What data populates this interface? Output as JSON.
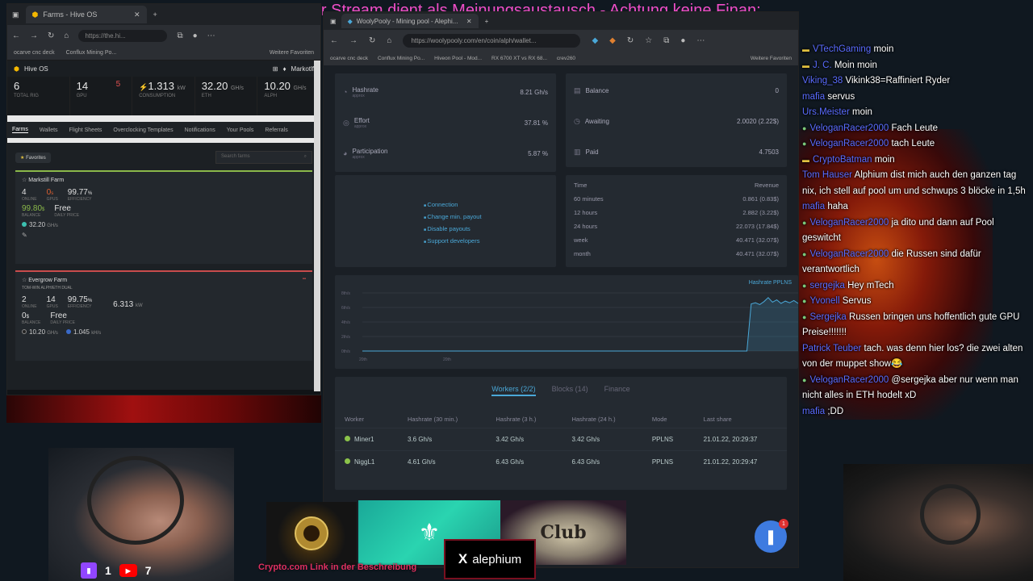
{
  "ticker": "zberatung, dieser Stream dient als Meinungsaustausch - Achtung keine Finan:",
  "left_browser": {
    "tab_title": "Farms - Hive OS",
    "url": "https://the.hi...",
    "bookmarks": [
      "ocarve cnc deck",
      "Conflux Mining Po...",
      "Weitere Favoriten"
    ],
    "app_name": "Hive OS",
    "menu_right": "Markotlf",
    "stats": [
      {
        "value": "6",
        "unit": "",
        "label": "TOTAL RIG"
      },
      {
        "value": "14",
        "unit": "",
        "extra": "5",
        "label": "GPU"
      },
      {
        "value": "1.313",
        "unit": "kW",
        "label": "CONSUMPTION"
      },
      {
        "value": "32.20",
        "unit": "GH/s",
        "label": "ETH"
      },
      {
        "value": "10.20",
        "unit": "GH/s",
        "label": "ALPH"
      }
    ],
    "tabs": [
      "Farms",
      "Wallets",
      "Flight Sheets",
      "Overclocking Templates",
      "Notifications",
      "Your Pools",
      "Referrals"
    ],
    "favorites_label": "Favorites",
    "search_placeholder": "Search farms",
    "farms": [
      {
        "name": "Markstill Farm",
        "online": "4",
        "online_label": "ONLINE",
        "gpus": "0",
        "gpus_unit": "s",
        "gpus_label": "GPUS",
        "efficiency": "99.77",
        "efficiency_unit": "%",
        "efficiency_label": "EFFICIENCY",
        "balance": "99.80",
        "balance_unit": "$",
        "balance_label": "BALANCE",
        "daily": "Free",
        "daily_label": "DAILY PRICE",
        "hashrate": "32.20",
        "hashrate_unit": "GH/s"
      },
      {
        "name": "Evergrow Farm",
        "sub": "TOM-WIN  ALPH/ETH DUAL",
        "online": "2",
        "online_label": "ONLINE",
        "gpus": "14",
        "gpus_label": "GPUS",
        "efficiency": "99.75",
        "efficiency_unit": "%",
        "efficiency_label": "EFFICIENCY",
        "power": "6.313",
        "power_unit": "kW",
        "balance": "0",
        "balance_unit": "$",
        "balance_label": "BALANCE",
        "daily": "Free",
        "daily_label": "DAILY PRICE",
        "hash1": "10.20",
        "hash1_unit": "GH/s",
        "hash2": "1.045",
        "hash2_unit": "kH/s"
      }
    ]
  },
  "center_browser": {
    "tab_title": "WoolyPooly - Mining pool - Alephi...",
    "url": "https://woolypooly.com/en/coin/alph/wallet...",
    "bookmarks": [
      "ocarve cnc deck",
      "Conflux Mining Po...",
      "Hiveon Pool - Mod...",
      "RX 6700 XT vs RX 68...",
      "crev260",
      "Weitere Favoriten"
    ],
    "stats_left": [
      {
        "label": "Hashrate",
        "sub": "approx",
        "value": "8.21 Gh/s",
        "icon": "gauge-icon"
      },
      {
        "label": "Effort",
        "sub": "approx",
        "value": "37.81 %",
        "icon": "target-icon"
      },
      {
        "label": "Participation",
        "sub": "approx",
        "value": "5.87 %",
        "icon": "pie-icon"
      }
    ],
    "stats_right": [
      {
        "label": "Balance",
        "value": "0",
        "icon": "wallet-icon"
      },
      {
        "label": "Awaiting",
        "value": "2.0020 (2.22$)",
        "icon": "clock-icon"
      },
      {
        "label": "Paid",
        "value": "4.7503",
        "icon": "coins-icon"
      }
    ],
    "links": [
      "Connection",
      "Change min. payout",
      "Disable payouts",
      "Support developers"
    ],
    "revenue": {
      "headers": [
        "Time",
        "Revenue"
      ],
      "rows": [
        [
          "60 minutes",
          "0.861 (0.83$)"
        ],
        [
          "12 hours",
          "2.882 (3.22$)"
        ],
        [
          "24 hours",
          "22.073 (17.84$)"
        ],
        [
          "week",
          "40.471 (32.07$)"
        ],
        [
          "month",
          "40.471 (32.07$)"
        ]
      ]
    },
    "chart_legend": "Hashrate PPLNS",
    "chart_data": {
      "type": "line",
      "title": "",
      "xlabel": "",
      "ylabel": "",
      "y_ticks": [
        "8th/s",
        "6th/s",
        "4th/s",
        "2th/s",
        "0th/s"
      ],
      "x_ticks": [
        "20th",
        "20th"
      ],
      "ylim": [
        0,
        10
      ],
      "series": [
        {
          "name": "Hashrate PPLNS",
          "values": [
            0,
            0,
            0,
            0,
            0,
            0,
            0,
            0,
            0,
            0,
            0,
            0,
            0,
            0,
            0,
            0,
            0,
            0,
            0,
            0,
            0,
            0,
            0,
            0,
            0,
            0,
            0,
            0,
            0,
            0,
            0,
            0,
            0,
            0,
            0,
            0,
            0,
            0,
            0,
            0,
            0,
            0,
            0,
            0,
            0,
            0,
            0,
            0,
            0,
            0,
            0,
            0,
            0,
            0,
            0,
            0,
            0,
            0,
            0,
            0,
            0,
            0,
            0,
            0,
            0,
            0,
            0,
            0,
            0,
            0,
            0,
            0,
            0,
            0,
            0,
            0,
            0,
            0,
            0,
            0,
            0,
            0,
            0,
            0,
            0,
            0,
            0,
            0,
            0,
            0,
            0,
            8.1,
            8.3,
            8.0,
            8.5,
            9.2,
            8.4,
            8.8,
            8.2,
            8.6,
            8.3,
            8.7,
            8.2
          ]
        }
      ]
    },
    "worker_tabs": [
      "Workers  (2/2)",
      "Blocks  (14)",
      "Finance"
    ],
    "worker_headers": [
      "Worker",
      "Hashrate (30 min.)",
      "Hashrate (3 h.)",
      "Hashrate (24 h.)",
      "Mode",
      "Last share"
    ],
    "workers": [
      [
        "Miner1",
        "3.6 Gh/s",
        "3.42 Gh/s",
        "3.42 Gh/s",
        "PPLNS",
        "21.01.22, 20:29:37"
      ],
      [
        "NiggL1",
        "4.61 Gh/s",
        "6.43 Gh/s",
        "6.43 Gh/s",
        "PPLNS",
        "21.01.22, 20:29:47"
      ]
    ],
    "chat_badge": "1"
  },
  "chat": [
    {
      "user": "VTechGaming",
      "text": "moin",
      "icon": "star"
    },
    {
      "user": "J. C.",
      "text": "Moin moin",
      "icon": "star"
    },
    {
      "user": "Viking_38",
      "text": "Vikink38=Raffiniert Ryder",
      "icon": ""
    },
    {
      "user": "mafia",
      "text": "servus",
      "icon": ""
    },
    {
      "user": "Urs.Meister",
      "text": "moin",
      "icon": ""
    },
    {
      "user": "VeloganRacer2000",
      "text": "Fach Leute",
      "icon": "heart"
    },
    {
      "user": "VeloganRacer2000",
      "text": "tach Leute",
      "icon": "heart"
    },
    {
      "user": "CryptoBatman",
      "text": "moin",
      "icon": "star"
    },
    {
      "user": "Tom Hauser",
      "text": "Alphium dist mich auch den ganzen tag nix, ich stell auf pool um und schwups 3 blöcke in 1,5h",
      "icon": ""
    },
    {
      "user": "mafia",
      "text": "haha",
      "icon": ""
    },
    {
      "user": "VeloganRacer2000",
      "text": "ja dito und dann auf Pool geswitcht",
      "icon": "heart"
    },
    {
      "user": "VeloganRacer2000",
      "text": "die Russen sind dafür verantwortlich",
      "icon": "heart"
    },
    {
      "user": "sergejka",
      "text": "Hey mTech",
      "icon": "heart"
    },
    {
      "user": "Yvonell",
      "text": "Servus",
      "icon": "heart"
    },
    {
      "user": "Sergejka",
      "text": "Russen bringen uns hoffentlich gute GPU Preise!!!!!!!",
      "icon": "heart"
    },
    {
      "user": "Patrick Teuber",
      "text": "tach. was denn hier los? die zwei alten von der muppet show😂",
      "icon": ""
    },
    {
      "user": "VeloganRacer2000",
      "text": "@sergejka aber nur wenn man nicht alles in ETH hodelt xD",
      "icon": "heart"
    },
    {
      "user": "mafia",
      "text": ";DD",
      "icon": ""
    }
  ],
  "overlay": {
    "aleph_text": "alephium",
    "promo_text": "Crypto.com Link in der Beschreibung",
    "twitch_count": "1",
    "youtube_count": "7",
    "logo3_text": "Club"
  }
}
